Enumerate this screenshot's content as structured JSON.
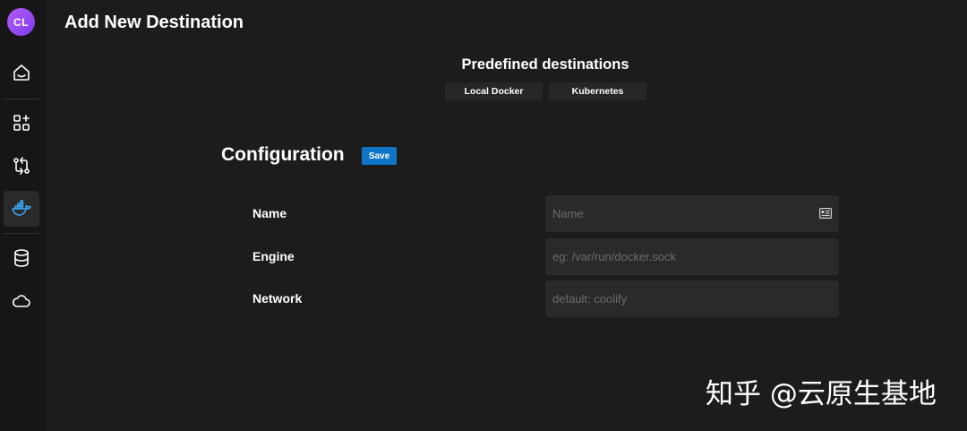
{
  "sidebar": {
    "avatar_initials": "CL",
    "items": [
      {
        "name": "dashboard",
        "icon": "home-icon",
        "active": false
      },
      {
        "name": "applications",
        "icon": "apps-add-icon",
        "active": false
      },
      {
        "name": "git-sources",
        "icon": "git-compare-icon",
        "active": false
      },
      {
        "name": "destinations",
        "icon": "docker-icon",
        "active": true
      },
      {
        "name": "databases",
        "icon": "database-icon",
        "active": false
      },
      {
        "name": "services",
        "icon": "cloud-icon",
        "active": false
      }
    ]
  },
  "header": {
    "title": "Add New Destination"
  },
  "predefined": {
    "title": "Predefined destinations",
    "buttons": [
      "Local Docker",
      "Kubernetes"
    ]
  },
  "configuration": {
    "title": "Configuration",
    "save_label": "Save",
    "fields": [
      {
        "label": "Name",
        "value": "",
        "placeholder": "Name"
      },
      {
        "label": "Engine",
        "value": "",
        "placeholder": "eg: /var/run/docker.sock"
      },
      {
        "label": "Network",
        "value": "",
        "placeholder": "default: coolify"
      }
    ]
  },
  "watermark": "知乎 @云原生基地",
  "colors": {
    "background": "#1c1c1c",
    "sidebar": "#161616",
    "input_bg": "#2a2a2a",
    "save_button": "#0e75c7",
    "docker_icon": "#3ba3f0",
    "avatar": "#8b46ef"
  }
}
